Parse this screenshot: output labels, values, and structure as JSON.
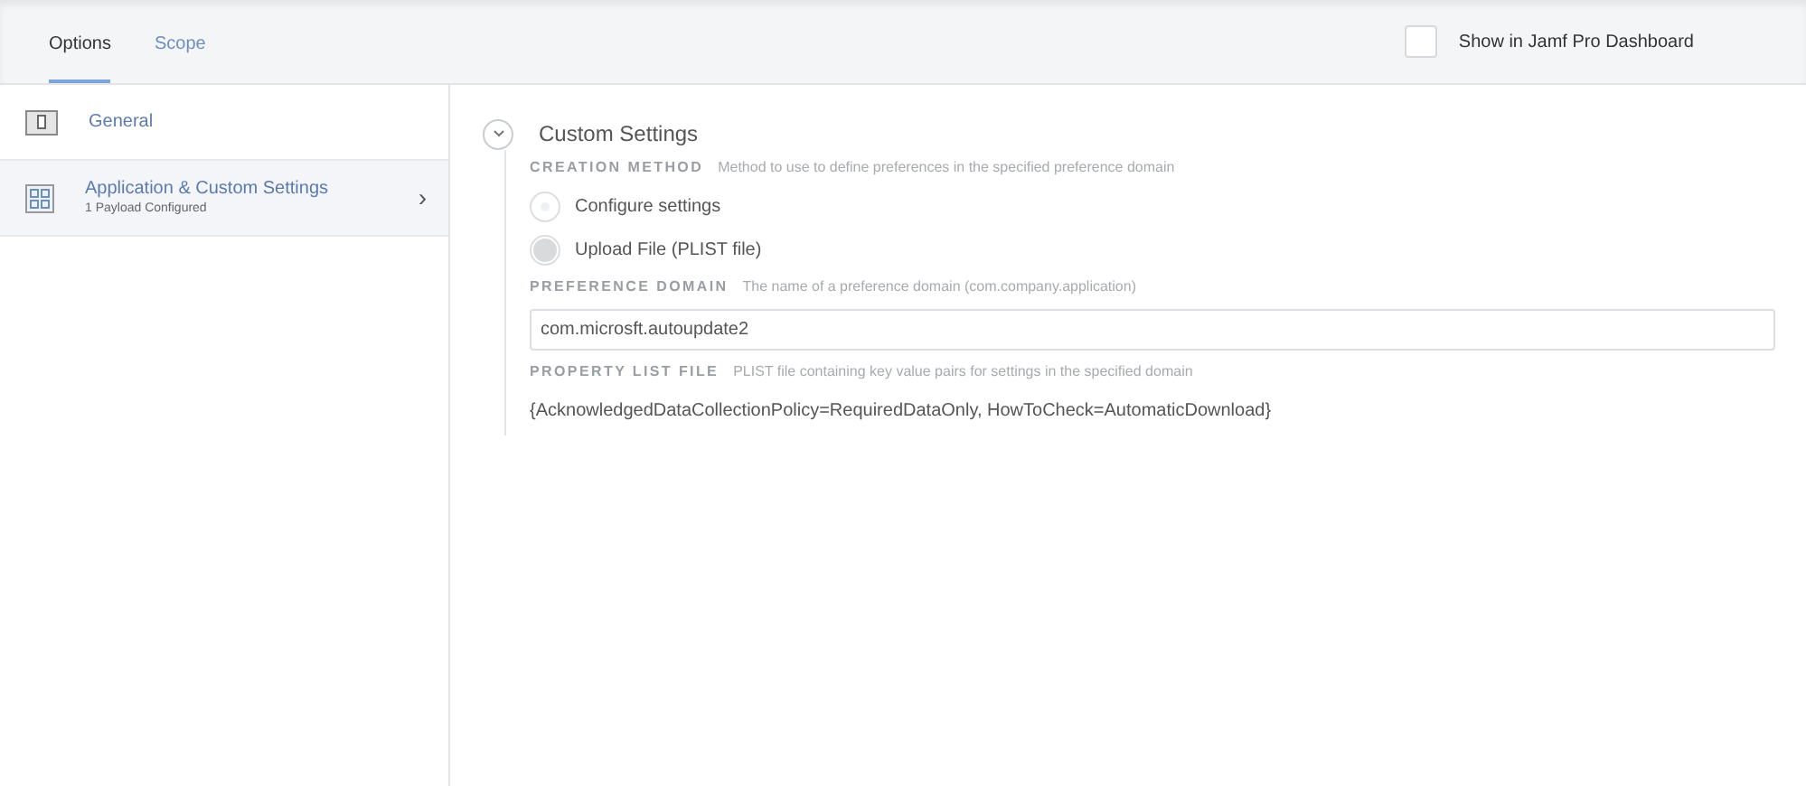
{
  "tabs": [
    {
      "label": "Options",
      "selected": true
    },
    {
      "label": "Scope",
      "selected": false
    }
  ],
  "dashboard": {
    "label": "Show in Jamf Pro Dashboard",
    "checked": false
  },
  "sidebar": {
    "items": [
      {
        "kind": "switch",
        "title": "General",
        "selected": false
      },
      {
        "kind": "grid",
        "title": "Application & Custom Settings",
        "subtitle": "1 Payload Configured",
        "selected": true,
        "chevron": "›"
      }
    ]
  },
  "section": {
    "title": "Custom Settings",
    "expanded": true,
    "creation_method": {
      "label": "CREATION METHOD",
      "hint": "Method to use to define preferences in the specified preference domain",
      "options": [
        {
          "label": "Configure settings",
          "selected": false
        },
        {
          "label": "Upload File (PLIST file)",
          "selected": true
        }
      ]
    },
    "preference_domain": {
      "label": "PREFERENCE DOMAIN",
      "hint": "The name of a preference domain (com.company.application)",
      "value": "com.microsft.autoupdate2"
    },
    "property_list_file": {
      "label": "PROPERTY LIST FILE",
      "hint": "PLIST file containing key value pairs for settings in the specified domain",
      "value": "{AcknowledgedDataCollectionPolicy=RequiredDataOnly, HowToCheck=AutomaticDownload}"
    }
  }
}
